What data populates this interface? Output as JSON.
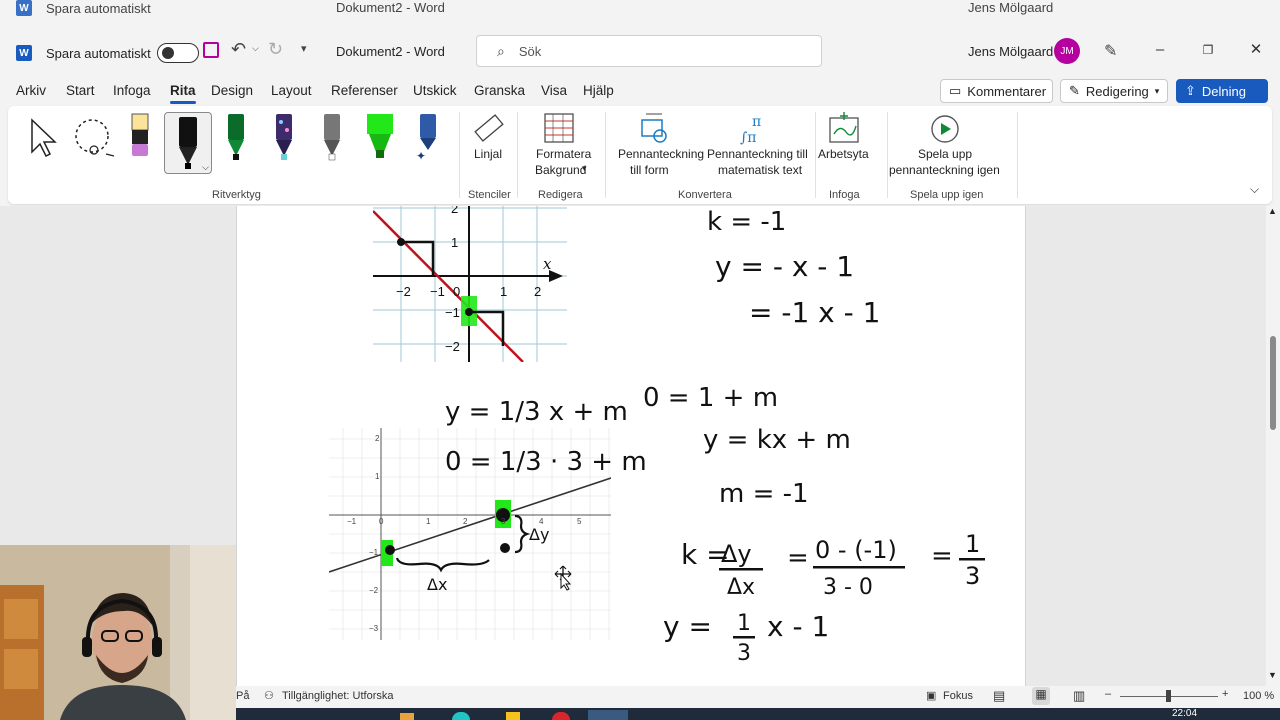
{
  "window": {
    "autosave_label": "Spara automatiskt",
    "doc_title": "Dokument2 - Word",
    "search_placeholder": "Sök",
    "user_name": "Jens Mölgaard",
    "user_initials": "JM",
    "word_logo": "W"
  },
  "menu": {
    "tabs": [
      "Arkiv",
      "Start",
      "Infoga",
      "Rita",
      "Design",
      "Layout",
      "Referenser",
      "Utskick",
      "Granska",
      "Visa",
      "Hjälp"
    ],
    "active_tab": "Rita",
    "comments_label": "Kommentarer",
    "editing_label": "Redigering",
    "share_label": "Delning"
  },
  "ribbon": {
    "groups": {
      "drawing_tools": "Ritverktyg",
      "stencils": "Stenciler",
      "edit": "Redigera",
      "convert": "Konvertera",
      "insert": "Infoga",
      "replay": "Spela upp igen"
    },
    "ruler_label": "Linjal",
    "format_bg_label_1": "Formatera",
    "format_bg_label_2": "Bakgrund",
    "ink_to_shape_1": "Pennanteckning",
    "ink_to_shape_2": "till form",
    "ink_to_math_1": "Pennanteckning till",
    "ink_to_math_2": "matematisk text",
    "canvas_label": "Arbetsyta",
    "replay_1": "Spela upp",
    "replay_2": "pennanteckning igen"
  },
  "document": {
    "graph1": {
      "ticks_x": [
        "−2",
        "−1",
        "0",
        "1",
        "2"
      ],
      "ticks_y": [
        "2",
        "1",
        "−1",
        "−2"
      ],
      "axis_label": "x"
    },
    "graph2": {
      "ticks_x": [
        "−1",
        "0",
        "1",
        "2",
        "3",
        "4",
        "5"
      ],
      "ticks_y": [
        "2",
        "1",
        "−1",
        "−2",
        "−3"
      ]
    },
    "handwriting": {
      "k_minus_1": "k = -1",
      "y_eq_1": "y = - x - 1",
      "y_eq_2": "= -1 x - 1",
      "eq_a": "0 = 1 + m",
      "eq_b": "y = kx + m",
      "eq_c": "m = -1",
      "y_third": "y = 1/3 x + m",
      "zero_eq": "0 = 1/3 · 3 + m",
      "k_frac_num": "Δy",
      "k_frac_den": "Δx",
      "k_frac2_num": "0 - (-1)",
      "k_frac2_den": "3 - 0",
      "k_result_num": "1",
      "k_result_den": "3",
      "final_y": "y = 1/3 x - 1",
      "delta_x": "Δx",
      "delta_y": "Δy",
      "k_symbol": "k =",
      "eq_symbol": "=",
      "y_final_lhs": "y =",
      "y_final_rhs": "x - 1"
    }
  },
  "status": {
    "page_text": "På",
    "accessibility": "Tillgänglighet: Utforska",
    "focus": "Fokus",
    "zoom": "100 %",
    "clock": "22:04"
  },
  "colors": {
    "accent": "#185abd",
    "highlight_green": "#22e81a",
    "red_line": "#c0121c",
    "avatar": "#b4009e"
  }
}
